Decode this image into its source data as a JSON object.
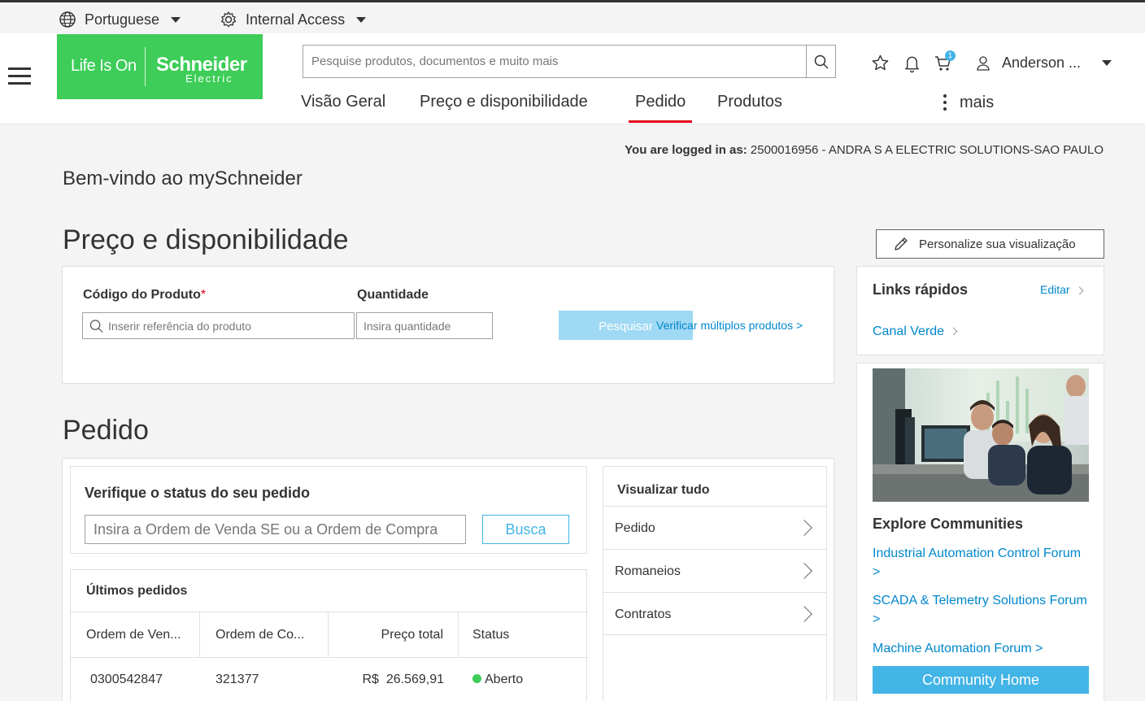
{
  "util": {
    "language": "Portuguese",
    "access": "Internal Access"
  },
  "header": {
    "logo_tagline": "Life Is On",
    "logo_brand": "Schneider",
    "logo_sub": "Electric",
    "search_placeholder": "Pesquise produtos, documentos e muito mais",
    "cart_count": "1",
    "user_name": "Anderson ...",
    "nav": [
      "Visão Geral",
      "Preço e disponibilidade",
      "Pedido",
      "Produtos"
    ],
    "more": "mais",
    "active_nav": "Pedido"
  },
  "logged": {
    "label": "You are logged in as:",
    "value": "2500016956 - ANDRA S A ELECTRIC SOLUTIONS-SAO PAULO"
  },
  "welcome": "Bem-vindo ao mySchneider",
  "price": {
    "title": "Preço e disponibilidade",
    "personalize": "Personalize sua visualização",
    "code_label": "Código do Produto",
    "required_mark": "*",
    "qty_label": "Quantidade",
    "code_placeholder": "Inserir referência do produto",
    "qty_placeholder": "Insira quantidade",
    "search_button": "Pesquisar",
    "multi_link": "Verificar múltiplos produtos >"
  },
  "quick_links": {
    "title": "Links rápidos",
    "edit": "Editar",
    "items": [
      "Canal Verde"
    ]
  },
  "order": {
    "title": "Pedido",
    "status_title": "Verifique o status do seu pedido",
    "status_placeholder": "Insira a Ordem de Venda SE ou a Ordem de Compra",
    "status_button": "Busca",
    "latest_title": "Últimos pedidos",
    "columns": [
      "Ordem de Ven...",
      "Ordem de Co...",
      "Preço total",
      "Status"
    ],
    "rows": [
      {
        "so": "0300542847",
        "po": "321377",
        "currency": "R$",
        "total": "26.569,91",
        "status": "Aberto"
      }
    ]
  },
  "view_all": {
    "title": "Visualizar tudo",
    "items": [
      "Pedido",
      "Romaneios",
      "Contratos"
    ]
  },
  "communities": {
    "title": "Explore Communities",
    "links": [
      {
        "text": "Industrial Automation Control Forum",
        "arrow": ">"
      },
      {
        "text": "SCADA & Telemetry Solutions Forum",
        "arrow": ">"
      },
      {
        "text": "Machine Automation Forum >",
        "arrow": ""
      }
    ],
    "home_button": "Community Home"
  },
  "colors": {
    "brand_green": "#3dcd58",
    "link_blue": "#0087cd",
    "accent_red": "#e1001a",
    "button_blue": "#42b4e6",
    "status_open": "#3dcd58"
  }
}
